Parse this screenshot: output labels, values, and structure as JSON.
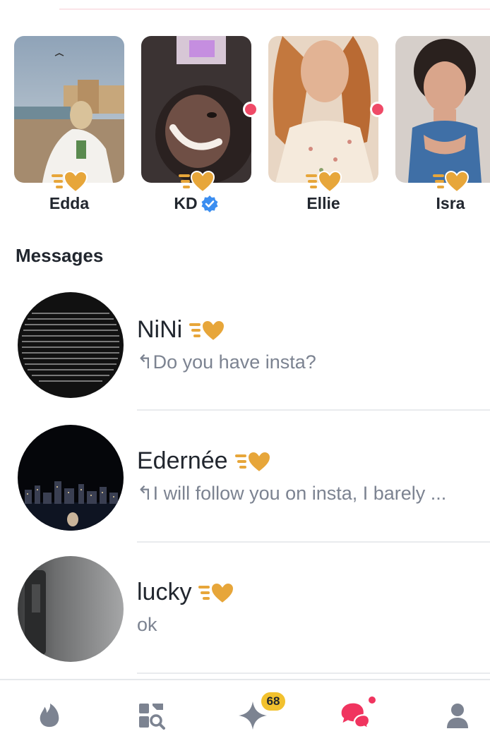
{
  "matches": [
    {
      "name": "Edda",
      "verified": false,
      "online": false
    },
    {
      "name": "KD",
      "verified": true,
      "online": true
    },
    {
      "name": "Ellie",
      "verified": false,
      "online": true
    },
    {
      "name": "Isra",
      "verified": false,
      "online": false
    }
  ],
  "messages_title": "Messages",
  "messages": [
    {
      "name": "NiNi",
      "preview": "↰Do you have insta?"
    },
    {
      "name": "Edernée",
      "preview": "↰I will follow you on insta, I barely ..."
    },
    {
      "name": "lucky",
      "preview": "ok"
    }
  ],
  "nav": {
    "items": [
      "flame-icon",
      "explore-icon",
      "likes-icon",
      "chat-icon",
      "profile-icon"
    ],
    "likes_badge": "68"
  },
  "colors": {
    "accent": "#f0345f",
    "super_like_gold": "#e7a63a",
    "online_dot": "#ef4a67",
    "verified_blue": "#3c8ef0",
    "badge_yellow": "#f2c12e",
    "nav_gray": "#7c8391"
  }
}
